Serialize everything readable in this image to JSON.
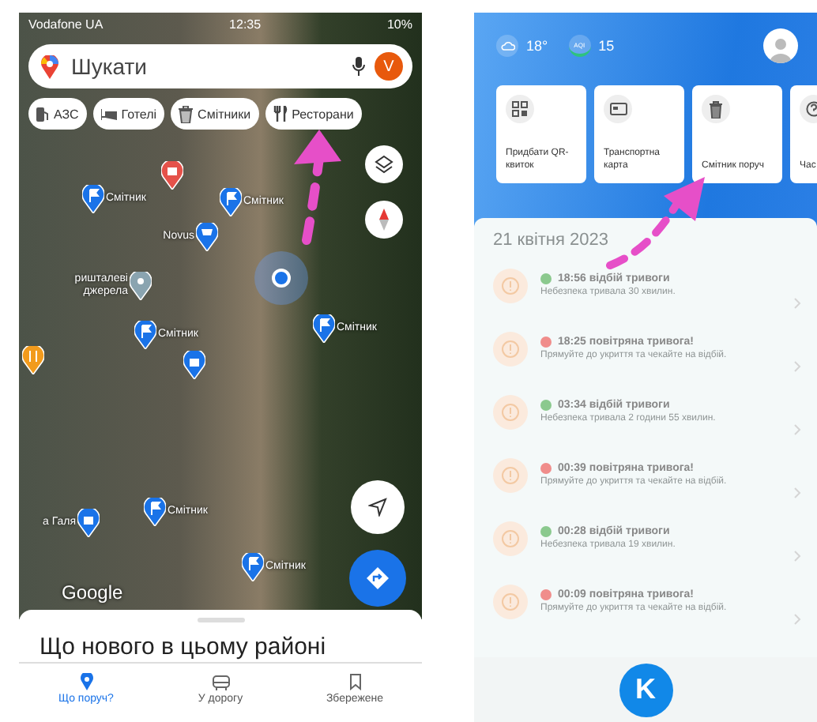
{
  "maps_screen": {
    "status_bar": {
      "carrier": "Vodafone UA",
      "time": "12:35",
      "battery": "10%"
    },
    "search": {
      "placeholder": "Шукати",
      "avatar": "V"
    },
    "chips": [
      {
        "label": "АЗС",
        "kind": "fuel"
      },
      {
        "label": "Готелі",
        "kind": "hotel"
      },
      {
        "label": "Смітники",
        "kind": "trash"
      },
      {
        "label": "Ресторани",
        "kind": "food"
      }
    ],
    "map_pins": [
      {
        "kind": "poi"
      },
      {
        "kind": "flag",
        "label": "Смітник"
      },
      {
        "kind": "flag",
        "label": "Смітник"
      },
      {
        "kind": "shop",
        "label": "Novus"
      },
      {
        "kind": "place",
        "label": "ришталеві джерела"
      },
      {
        "kind": "flag",
        "label": "Смітник"
      },
      {
        "kind": "food"
      },
      {
        "kind": "bag"
      },
      {
        "kind": "flag",
        "label": "Смітник"
      },
      {
        "kind": "bag",
        "label": "а Галя"
      },
      {
        "kind": "flag",
        "label": "Смітник"
      },
      {
        "kind": "flag",
        "label": "Смітник"
      }
    ],
    "map_logo": "Google",
    "sheet_title": "Що нового в цьому районі",
    "nav": [
      {
        "label": "Що поруч?",
        "kind": "pin",
        "selected": true
      },
      {
        "label": "У дорогу",
        "kind": "car",
        "selected": false
      },
      {
        "label": "Збережене",
        "kind": "bookmark",
        "selected": false
      }
    ]
  },
  "city_app": {
    "weather": {
      "temperature": "18°",
      "aqi_label": "AQI",
      "aqi": "15"
    },
    "services": [
      {
        "label": "Придбати QR-квиток",
        "kind": "qr"
      },
      {
        "label": "Транспортна карта",
        "kind": "card"
      },
      {
        "label": "Смітник поруч",
        "kind": "trash"
      },
      {
        "label": "Час",
        "kind": "help"
      }
    ],
    "alerts_date": "21 квітня 2023",
    "alerts": [
      {
        "title": "18:56 відбій тривоги",
        "text": "Небезпека тривала 30 хвилин.",
        "color": "#8bc98e"
      },
      {
        "title": "18:25 повітряна тривога!",
        "text": "Прямуйте до укриття та чекайте на відбій.",
        "color": "#f08d8b"
      },
      {
        "title": "03:34 відбій тривоги",
        "text": "Небезпека тривала 2 години 55 хвилин.",
        "color": "#8bc98e"
      },
      {
        "title": "00:39 повітряна тривога!",
        "text": "Прямуйте до укриття та чекайте на відбій.",
        "color": "#f08d8b"
      },
      {
        "title": "00:28 відбій тривоги",
        "text": "Небезпека тривала 19 хвилин.",
        "color": "#8bc98e"
      },
      {
        "title": "00:09 повітряна тривога!",
        "text": "Прямуйте до укриття та чекайте на відбій.",
        "color": "#f08d8b"
      }
    ],
    "fab": "K"
  }
}
